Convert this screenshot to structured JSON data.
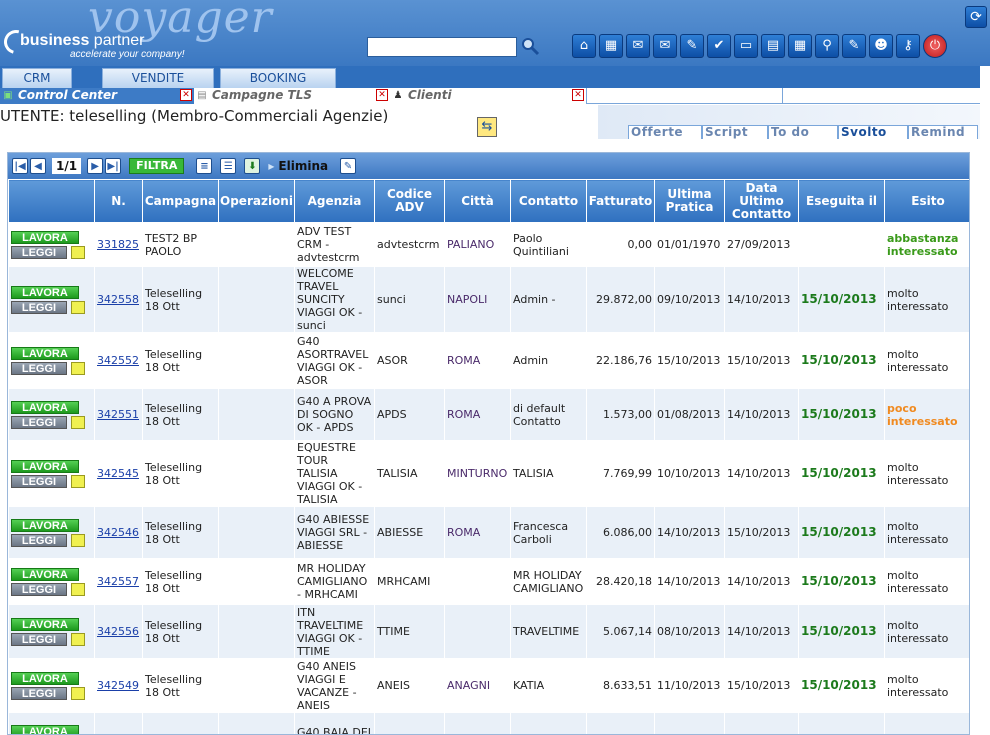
{
  "header": {
    "logo_title": "voyager",
    "logo_brand_bold": "business",
    "logo_brand_light": " partner",
    "logo_tagline": "accelerate your company!",
    "search_value": "",
    "icons": [
      "home-icon",
      "calendar-icon",
      "mail-in-icon",
      "mail-out-icon",
      "pen-icon",
      "checklist-icon",
      "briefcase-icon",
      "agenda-icon",
      "calculator-icon",
      "magnifier-icon",
      "edit-note-icon",
      "users-icon",
      "key-icon",
      "power-icon"
    ]
  },
  "nav": {
    "tabs": [
      "CRM",
      "VENDITE",
      "BOOKING"
    ]
  },
  "subtabs": [
    {
      "label": "Control Center",
      "active": true
    },
    {
      "label": "Campagne TLS",
      "active": false
    },
    {
      "label": "Clienti",
      "active": false
    }
  ],
  "user_line": "UTENTE: teleselling (Membro-Commerciali Agenzie)",
  "panel_tabs": [
    "Offerte",
    "Script",
    "To do",
    "Svolto",
    "Remind"
  ],
  "toolbar": {
    "pager": "1/1",
    "filtra": "FILTRA",
    "elimina": "Elimina"
  },
  "columns": [
    "",
    "N.",
    "Campagna",
    "Operazioni",
    "Agenzia",
    "Codice ADV",
    "Città",
    "Contatto",
    "Fatturato",
    "Ultima Pratica",
    "Data Ultimo Contatto",
    "Eseguita il",
    "Esito"
  ],
  "row_buttons": {
    "lavora": "LAVORA",
    "leggi": "LEGGI"
  },
  "rows": [
    {
      "n": "331825",
      "campagna": "TEST2 BP PAOLO",
      "operazioni": "",
      "agenzia": "ADV TEST CRM - advtestcrm",
      "codice": "advtestcrm",
      "citta": "PALIANO",
      "contatto": "Paolo Quintiliani",
      "fatturato": "0,00",
      "ultima": "01/01/1970",
      "data_contatto": "27/09/2013",
      "eseguita": "",
      "esito": "abbastanza interessato",
      "esito_color": "green"
    },
    {
      "n": "342558",
      "campagna": "Teleselling 18 Ott",
      "operazioni": "",
      "agenzia": "WELCOME TRAVEL SUNCITY VIAGGI OK - sunci",
      "codice": "sunci",
      "citta": "NAPOLI",
      "contatto": "Admin -",
      "fatturato": "29.872,00",
      "ultima": "09/10/2013",
      "data_contatto": "14/10/2013",
      "eseguita": "15/10/2013",
      "esito": "molto interessato",
      "esito_color": "normal"
    },
    {
      "n": "342552",
      "campagna": "Teleselling 18 Ott",
      "operazioni": "",
      "agenzia": "G40 ASORTRAVEL VIAGGI OK - ASOR",
      "codice": "ASOR",
      "citta": "ROMA",
      "contatto": "Admin",
      "fatturato": "22.186,76",
      "ultima": "15/10/2013",
      "data_contatto": "15/10/2013",
      "eseguita": "15/10/2013",
      "esito": "molto interessato",
      "esito_color": "normal"
    },
    {
      "n": "342551",
      "campagna": "Teleselling 18 Ott",
      "operazioni": "",
      "agenzia": "G40 A PROVA DI SOGNO OK - APDS",
      "codice": "APDS",
      "citta": "ROMA",
      "contatto": "di default Contatto",
      "fatturato": "1.573,00",
      "ultima": "01/08/2013",
      "data_contatto": "14/10/2013",
      "eseguita": "15/10/2013",
      "esito": "poco interessato",
      "esito_color": "orange"
    },
    {
      "n": "342545",
      "campagna": "Teleselling 18 Ott",
      "operazioni": "",
      "agenzia": "EQUESTRE TOUR TALISIA VIAGGI OK - TALISIA",
      "codice": "TALISIA",
      "citta": "MINTURNO",
      "contatto": "TALISIA",
      "fatturato": "7.769,99",
      "ultima": "10/10/2013",
      "data_contatto": "14/10/2013",
      "eseguita": "15/10/2013",
      "esito": "molto interessato",
      "esito_color": "normal"
    },
    {
      "n": "342546",
      "campagna": "Teleselling 18 Ott",
      "operazioni": "",
      "agenzia": "G40 ABIESSE VIAGGI SRL - ABIESSE",
      "codice": "ABIESSE",
      "citta": "ROMA",
      "contatto": "Francesca Carboli",
      "fatturato": "6.086,00",
      "ultima": "14/10/2013",
      "data_contatto": "15/10/2013",
      "eseguita": "15/10/2013",
      "esito": "molto interessato",
      "esito_color": "normal"
    },
    {
      "n": "342557",
      "campagna": "Teleselling 18 Ott",
      "operazioni": "",
      "agenzia": "MR HOLIDAY CAMIGLIANO - MRHCAMI",
      "codice": "MRHCAMI",
      "citta": "",
      "contatto": "MR HOLIDAY CAMIGLIANO",
      "fatturato": "28.420,18",
      "ultima": "14/10/2013",
      "data_contatto": "14/10/2013",
      "eseguita": "15/10/2013",
      "esito": "molto interessato",
      "esito_color": "normal"
    },
    {
      "n": "342556",
      "campagna": "Teleselling 18 Ott",
      "operazioni": "",
      "agenzia": "ITN TRAVELTIME VIAGGI OK - TTIME",
      "codice": "TTIME",
      "citta": "",
      "contatto": "TRAVELTIME",
      "fatturato": "5.067,14",
      "ultima": "08/10/2013",
      "data_contatto": "14/10/2013",
      "eseguita": "15/10/2013",
      "esito": "molto interessato",
      "esito_color": "normal"
    },
    {
      "n": "342549",
      "campagna": "Teleselling 18 Ott",
      "operazioni": "",
      "agenzia": "G40 ANEIS VIAGGI E VACANZE - ANEIS",
      "codice": "ANEIS",
      "citta": "ANAGNI",
      "contatto": "KATIA",
      "fatturato": "8.633,51",
      "ultima": "11/10/2013",
      "data_contatto": "15/10/2013",
      "eseguita": "15/10/2013",
      "esito": "molto interessato",
      "esito_color": "normal"
    },
    {
      "n": "",
      "campagna": "",
      "operazioni": "",
      "agenzia": "G40 BAIA DEI",
      "codice": "",
      "citta": "",
      "contatto": "",
      "fatturato": "",
      "ultima": "",
      "data_contatto": "",
      "eseguita": "",
      "esito": "",
      "esito_color": "normal"
    }
  ]
}
